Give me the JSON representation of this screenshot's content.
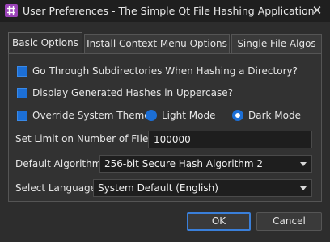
{
  "window": {
    "title": "User Preferences - The Simple Qt File Hashing Application",
    "close_glyph": "✕"
  },
  "tabs": [
    {
      "label": "Basic Options",
      "active": true
    },
    {
      "label": "Install Context Menu Options",
      "active": false
    },
    {
      "label": "Single File Algos",
      "active": false
    }
  ],
  "basic": {
    "subdirs_label": "Go Through Subdirectories When Hashing a Directory?",
    "subdirs_checked": false,
    "uppercase_label": "Display Generated Hashes in Uppercase?",
    "uppercase_checked": false,
    "override_label": "Override System Theme:",
    "override_checked": false,
    "light_label": "Light Mode",
    "light_selected": false,
    "dark_label": "Dark Mode",
    "dark_selected": true,
    "limit_label": "Set Limit on Number of FIles:",
    "limit_value": "100000",
    "algo_label": "Default Algorithm:",
    "algo_value": "256-bit Secure Hash Algorithm 2",
    "lang_label": "Select Language:",
    "lang_value": "System Default (English)"
  },
  "buttons": {
    "ok_label": "OK",
    "cancel_label": "Cancel"
  },
  "colors": {
    "accent": "#1c6fd6",
    "app_icon": "#9b43b8",
    "background": "#2d2d2d"
  },
  "icons": {
    "app": "hash-grid-icon",
    "close": "close-icon",
    "dropdown": "chevron-down-icon"
  }
}
